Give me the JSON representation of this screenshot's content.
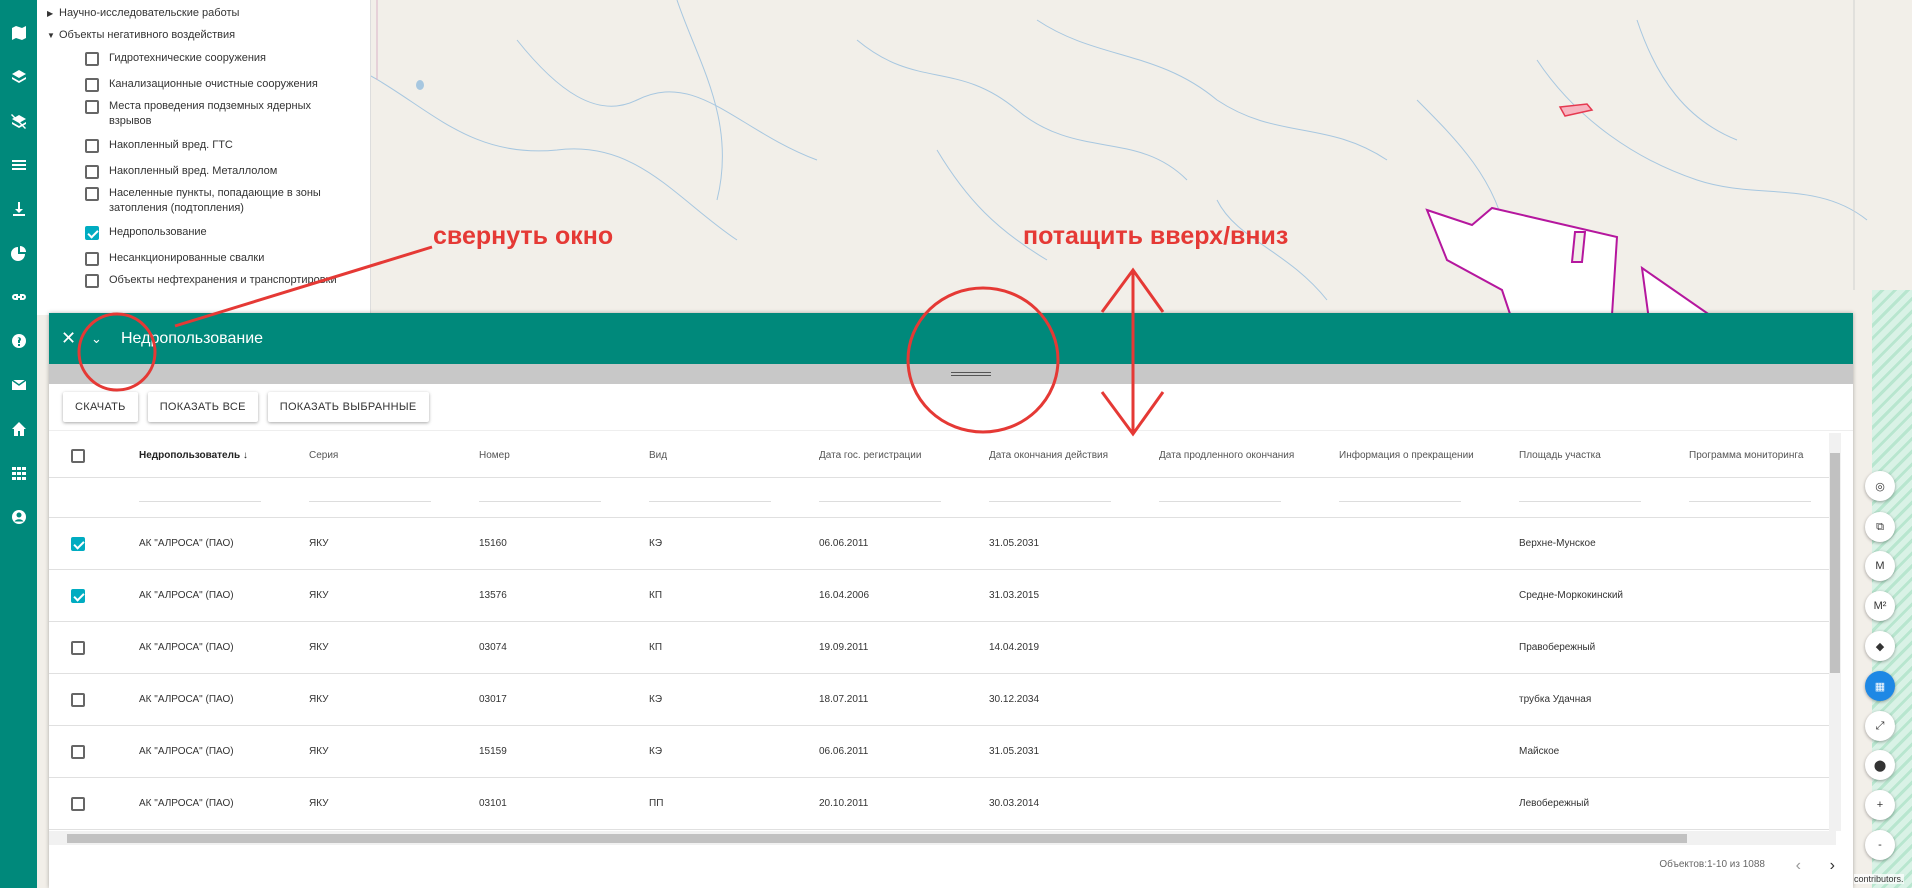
{
  "layer_panel": {
    "groups": [
      {
        "label": "Научно-исследовательские работы",
        "expanded": false
      },
      {
        "label": "Объекты негативного воздействия",
        "expanded": true
      }
    ],
    "layers": [
      {
        "label": "Гидротехнические сооружения",
        "checked": false
      },
      {
        "label": "Канализационные очистные сооружения",
        "checked": false
      },
      {
        "label": "Места проведения подземных ядерных взрывов",
        "checked": false
      },
      {
        "label": "Накопленный вред. ГТС",
        "checked": false
      },
      {
        "label": "Накопленный вред. Металлолом",
        "checked": false
      },
      {
        "label": "Населенные пункты, попадающие в зоны затопления (подтопления)",
        "checked": false
      },
      {
        "label": "Недропользование",
        "checked": true
      },
      {
        "label": "Несанкционированные свалки",
        "checked": false
      },
      {
        "label": "Объекты нефтехранения и транспортировки",
        "checked": false
      }
    ]
  },
  "annotations": {
    "collapse_hint": "свернуть окно",
    "drag_hint": "потащить вверх/вниз"
  },
  "table_window": {
    "title": "Недропользование",
    "close_icon": "close-icon",
    "collapse_icon": "chevron-down-icon",
    "buttons": {
      "download": "СКАЧАТЬ",
      "show_all": "ПОКАЗАТЬ ВСЕ",
      "show_selected": "ПОКАЗАТЬ ВЫБРАННЫЕ"
    },
    "columns": [
      "Недропользователь",
      "Серия",
      "Номер",
      "Вид",
      "Дата гос. регистрации",
      "Дата окончания действия",
      "Дата продленного окончания",
      "Информация о прекращении",
      "Площадь участка",
      "Программа мониторинга"
    ],
    "sorted_column": "Недропользователь",
    "rows": [
      {
        "checked": true,
        "cells": [
          "АК \"АЛРОСА\" (ПАО)",
          "ЯКУ",
          "15160",
          "КЭ",
          "06.06.2011",
          "31.05.2031",
          "",
          "",
          "Верхне-Мунское",
          ""
        ]
      },
      {
        "checked": true,
        "cells": [
          "АК \"АЛРОСА\" (ПАО)",
          "ЯКУ",
          "13576",
          "КП",
          "16.04.2006",
          "31.03.2015",
          "",
          "",
          "Средне-Моркокинский",
          ""
        ]
      },
      {
        "checked": false,
        "cells": [
          "АК \"АЛРОСА\" (ПАО)",
          "ЯКУ",
          "03074",
          "КП",
          "19.09.2011",
          "14.04.2019",
          "",
          "",
          "Правобережный",
          ""
        ]
      },
      {
        "checked": false,
        "cells": [
          "АК \"АЛРОСА\" (ПАО)",
          "ЯКУ",
          "03017",
          "КЭ",
          "18.07.2011",
          "30.12.2034",
          "",
          "",
          "трубка Удачная",
          ""
        ]
      },
      {
        "checked": false,
        "cells": [
          "АК \"АЛРОСА\" (ПАО)",
          "ЯКУ",
          "15159",
          "КЭ",
          "06.06.2011",
          "31.05.2031",
          "",
          "",
          "Майское",
          ""
        ]
      },
      {
        "checked": false,
        "cells": [
          "АК \"АЛРОСА\" (ПАО)",
          "ЯКУ",
          "03101",
          "ПП",
          "20.10.2011",
          "30.03.2014",
          "",
          "",
          "Левобережный",
          ""
        ]
      }
    ],
    "pager": {
      "text": "Объектов:1-10 из 1088",
      "prev_icon": "chevron-left-icon",
      "next_icon": "chevron-right-icon"
    }
  },
  "map_controls": [
    {
      "name": "locate-icon",
      "label": ""
    },
    {
      "name": "external-link-icon",
      "label": ""
    },
    {
      "name": "measure-length-button",
      "label": "М"
    },
    {
      "name": "measure-area-button",
      "label": "М²"
    },
    {
      "name": "shapes-icon",
      "label": ""
    },
    {
      "name": "calendar-icon",
      "label": ""
    },
    {
      "name": "fullscreen-icon",
      "label": ""
    },
    {
      "name": "marker-icon",
      "label": ""
    },
    {
      "name": "zoom-in-button",
      "label": "+"
    },
    {
      "name": "zoom-out-button",
      "label": "-"
    }
  ],
  "attribution": "contributors.",
  "colors": {
    "primary": "#00897b",
    "checkbox": "#00acc1",
    "annotation": "#e53935",
    "polygon": "#b5179e",
    "active_control": "#1e88e5"
  }
}
